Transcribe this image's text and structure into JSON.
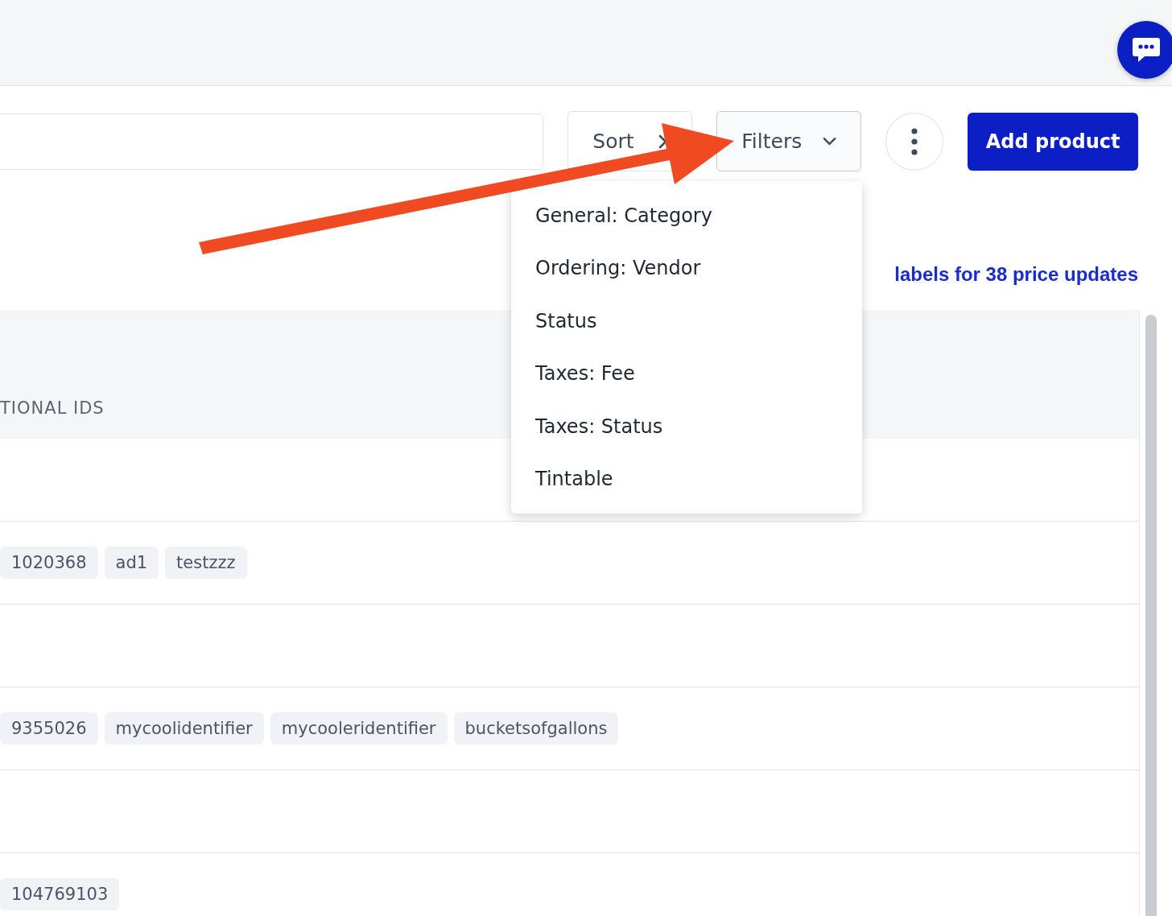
{
  "toolbar": {
    "sort_button": "Sort",
    "filters_button": {
      "label": "Filters",
      "expanded": true
    },
    "add_button": "Add product"
  },
  "filter_menu": [
    "General: Category",
    "Ordering: Vendor",
    "Status",
    "Taxes: Fee",
    "Taxes: Status",
    "Tintable"
  ],
  "notice_link": "labels for 38 price updates",
  "table": {
    "columns": [
      "TIONAL IDS"
    ],
    "rows": [
      {
        "kind": "empty"
      },
      {
        "kind": "ids",
        "ids": [
          "1020368",
          "ad1",
          "testzzz"
        ]
      },
      {
        "kind": "empty"
      },
      {
        "kind": "ids",
        "ids": [
          "9355026",
          "mycoolidentifier",
          "mycooleridentifier",
          "bucketsofgallons"
        ]
      },
      {
        "kind": "empty"
      },
      {
        "kind": "ids",
        "ids": [
          "104769103"
        ]
      }
    ]
  }
}
